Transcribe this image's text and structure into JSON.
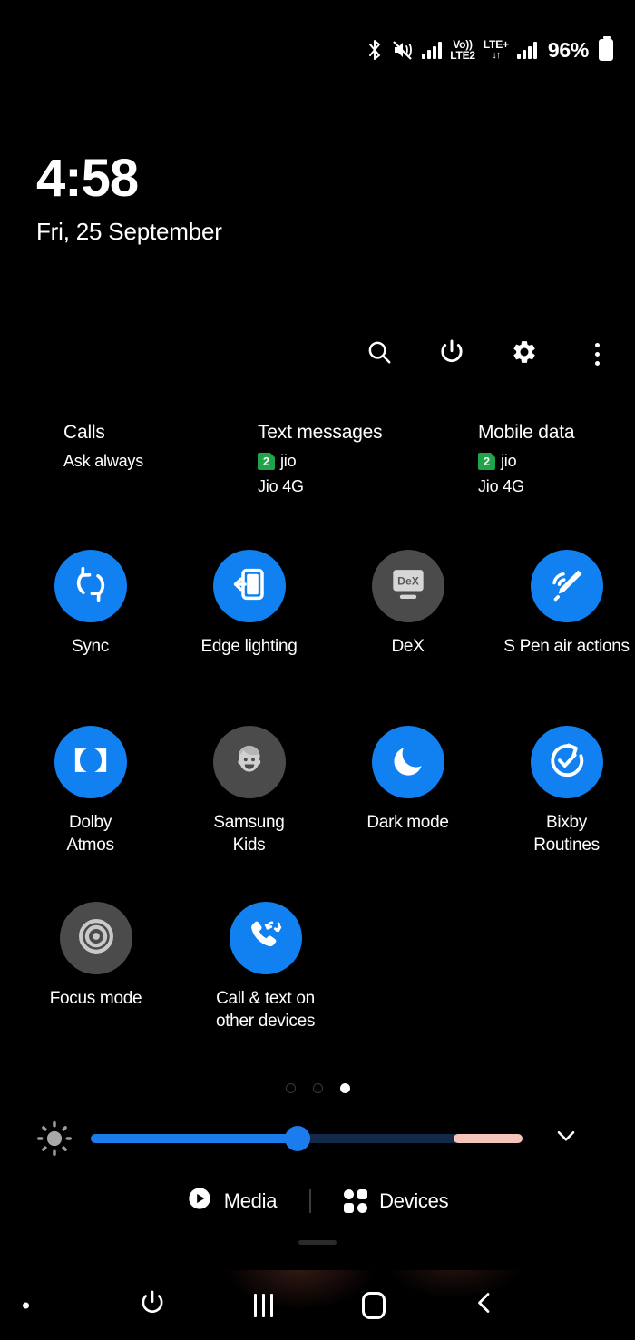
{
  "status_bar": {
    "bluetooth_icon": "bluetooth-icon",
    "sound_icon": "mute-vibrate-icon",
    "sim1_signal_icon": "signal-bars-icon",
    "volte_line1": "Vo))",
    "volte_line2": "LTE2",
    "network_line1": "LTE+",
    "network_line2": "↓↑",
    "sim2_signal_icon": "signal-bars-icon",
    "battery_percent": "96%",
    "battery_icon": "battery-full-icon"
  },
  "clock": {
    "time": "4:58",
    "date": "Fri, 25 September"
  },
  "toolbar": {
    "search": "search-icon",
    "power": "power-icon",
    "settings": "gear-icon",
    "more": "more-options-icon"
  },
  "sim_info": {
    "columns": [
      {
        "title": "Calls",
        "badge": "",
        "carrier": "Ask always",
        "network": ""
      },
      {
        "title": "Text messages",
        "badge": "2",
        "carrier": "jio",
        "network": "Jio 4G"
      },
      {
        "title": "Mobile data",
        "badge": "2",
        "carrier": "jio",
        "network": "Jio 4G"
      }
    ]
  },
  "tiles": {
    "rows": [
      [
        {
          "label": "Sync",
          "icon": "sync-icon",
          "state": "on"
        },
        {
          "label": "Edge lighting",
          "icon": "edge-lighting-icon",
          "state": "on"
        },
        {
          "label": "DeX",
          "icon": "dex-icon",
          "state": "off"
        },
        {
          "label": "S Pen air actions",
          "icon": "s-pen-air-actions-icon",
          "state": "on"
        }
      ],
      [
        {
          "label": "Dolby\nAtmos",
          "icon": "dolby-atmos-icon",
          "state": "on"
        },
        {
          "label": "Samsung\nKids",
          "icon": "samsung-kids-icon",
          "state": "off"
        },
        {
          "label": "Dark mode",
          "icon": "moon-icon",
          "state": "on"
        },
        {
          "label": "Bixby\nRoutines",
          "icon": "bixby-routines-icon",
          "state": "on"
        }
      ],
      [
        {
          "label": "Focus mode",
          "icon": "focus-mode-icon",
          "state": "off"
        },
        {
          "label": "Call & text on\nother devices",
          "icon": "call-text-other-devices-icon",
          "state": "on"
        }
      ]
    ]
  },
  "page_indicator": {
    "total": 3,
    "active_index": 2
  },
  "brightness": {
    "icon": "brightness-icon",
    "value_percent": 48,
    "high_zone_start_percent": 84,
    "expand_icon": "chevron-down-icon"
  },
  "media_bar": {
    "media_label": "Media",
    "media_icon": "play-circle-icon",
    "devices_label": "Devices",
    "devices_icon": "devices-grid-icon"
  },
  "nav_bar": {
    "power_icon": "power-icon",
    "recents_icon": "recents-icon",
    "home_icon": "home-icon",
    "back_icon": "back-icon"
  },
  "colors": {
    "accent_blue": "#1180f0",
    "tile_off_gray": "#4b4b4b",
    "sim_badge_green": "#1fa44a",
    "slider_high_pink": "#f6c4bb",
    "background": "#000000"
  }
}
